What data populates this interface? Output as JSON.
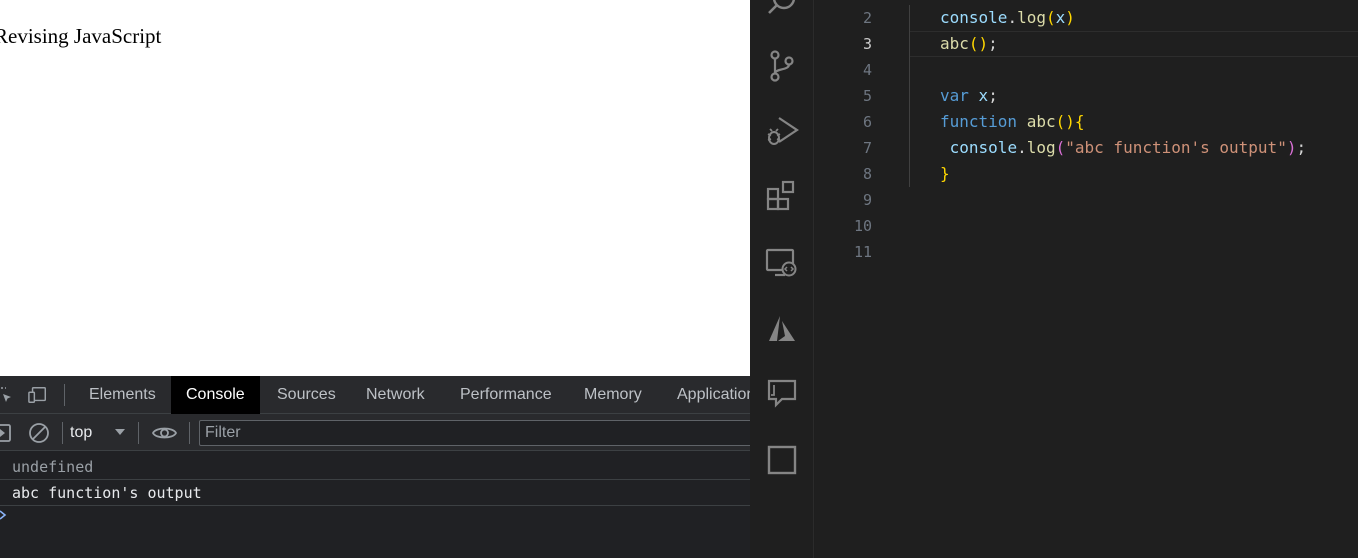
{
  "browser": {
    "page_heading": "Revising JavaScript"
  },
  "devtools": {
    "tabs": [
      "Elements",
      "Console",
      "Sources",
      "Network",
      "Performance",
      "Memory",
      "Application"
    ],
    "active_tab": "Console",
    "toolbar": {
      "context": "top",
      "filter_placeholder": "Filter"
    },
    "console_messages": [
      {
        "type": "result",
        "text": "undefined"
      },
      {
        "type": "log",
        "text": "abc function's output"
      }
    ]
  },
  "vscode": {
    "activity_icons": [
      "search-icon",
      "source-control-icon",
      "run-debug-icon",
      "extensions-icon",
      "remote-explorer-icon",
      "azure-icon",
      "comments-icon",
      "square-icon"
    ],
    "active_line": 3,
    "lines": [
      {
        "num": "2",
        "tokens": [
          {
            "t": "console",
            "c": "t-var"
          },
          {
            "t": ".",
            "c": "t-p"
          },
          {
            "t": "log",
            "c": "t-fn"
          },
          {
            "t": "(",
            "c": "t-b1"
          },
          {
            "t": "x",
            "c": "t-var"
          },
          {
            "t": ")",
            "c": "t-b1"
          }
        ]
      },
      {
        "num": "3",
        "tokens": [
          {
            "t": "abc",
            "c": "t-fn"
          },
          {
            "t": "()",
            "c": "t-b1"
          },
          {
            "t": ";",
            "c": "t-p"
          }
        ]
      },
      {
        "num": "4",
        "tokens": []
      },
      {
        "num": "5",
        "tokens": [
          {
            "t": "var",
            "c": "t-kw"
          },
          {
            "t": " ",
            "c": "t-p"
          },
          {
            "t": "x",
            "c": "t-var"
          },
          {
            "t": ";",
            "c": "t-p"
          }
        ]
      },
      {
        "num": "6",
        "tokens": [
          {
            "t": "function",
            "c": "t-kw"
          },
          {
            "t": " ",
            "c": "t-p"
          },
          {
            "t": "abc",
            "c": "t-fn"
          },
          {
            "t": "(){",
            "c": "t-b1"
          }
        ]
      },
      {
        "num": "7",
        "tokens": [
          {
            "t": " ",
            "c": "t-p"
          },
          {
            "t": "console",
            "c": "t-var"
          },
          {
            "t": ".",
            "c": "t-p"
          },
          {
            "t": "log",
            "c": "t-fn"
          },
          {
            "t": "(",
            "c": "t-b2"
          },
          {
            "t": "\"abc function's output\"",
            "c": "t-str"
          },
          {
            "t": ")",
            "c": "t-b2"
          },
          {
            "t": ";",
            "c": "t-p"
          }
        ]
      },
      {
        "num": "8",
        "tokens": [
          {
            "t": "}",
            "c": "t-b1"
          }
        ]
      },
      {
        "num": "9",
        "tokens": []
      },
      {
        "num": "10",
        "tokens": []
      },
      {
        "num": "11",
        "tokens": []
      }
    ]
  }
}
